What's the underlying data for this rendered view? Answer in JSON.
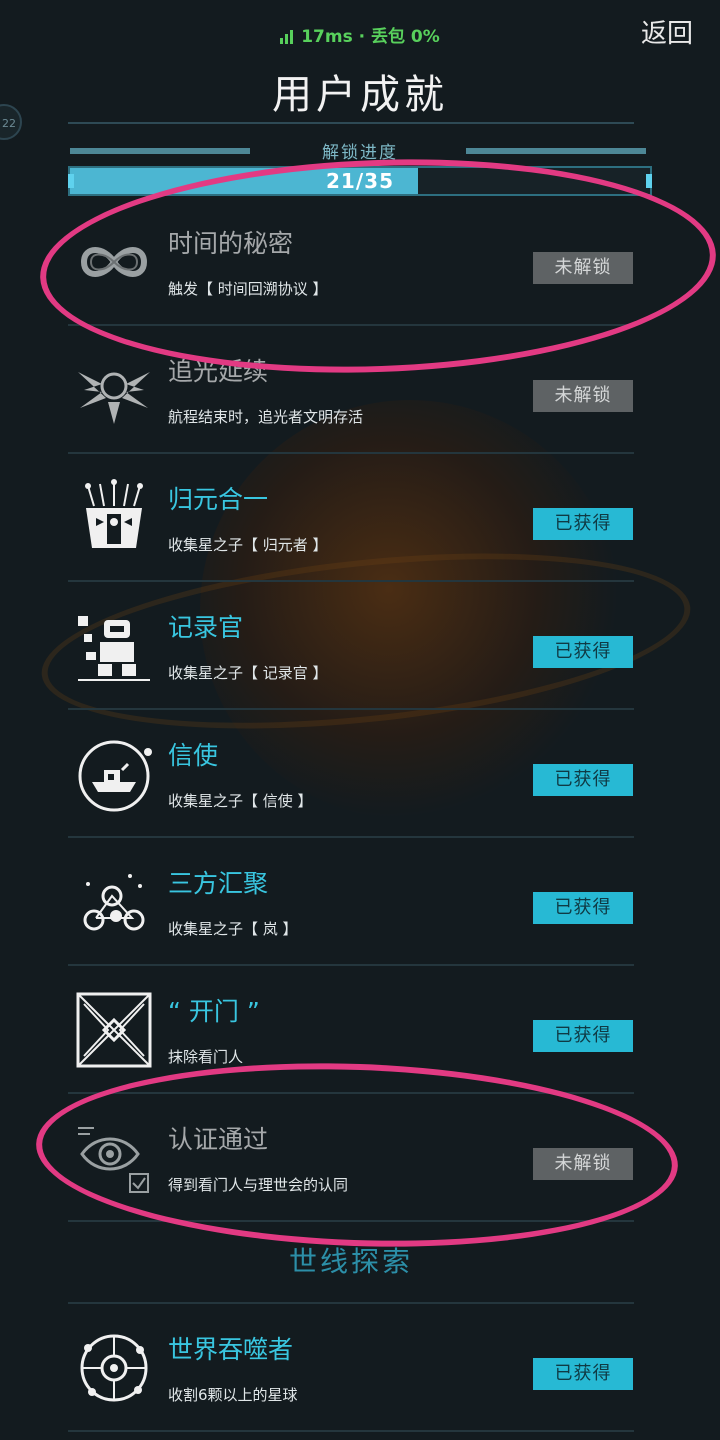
{
  "status": {
    "network": "17ms · 丢包 0%"
  },
  "header": {
    "back_label": "返回",
    "title": "用户成就",
    "side_badge": "22"
  },
  "progress": {
    "label": "解锁进度",
    "text": "21/35",
    "unlocked": 21,
    "total": 35
  },
  "achievements": [
    {
      "name": "时间的秘密",
      "desc": "触发【 时间回溯协议 】",
      "status": "未解锁",
      "icon": "infinity-icon"
    },
    {
      "name": "追光延续",
      "desc": "航程结束时，追光者文明存活",
      "status": "未解锁",
      "icon": "winged-emblem-icon"
    },
    {
      "name": "归元合一",
      "desc": "收集星之子【 归元者 】",
      "status": "已获得",
      "icon": "mask-icon"
    },
    {
      "name": "记录官",
      "desc": "收集星之子【 记录官 】",
      "status": "已获得",
      "icon": "robot-icon"
    },
    {
      "name": "信使",
      "desc": "收集星之子【 信使 】",
      "status": "已获得",
      "icon": "ship-circle-icon"
    },
    {
      "name": "三方汇聚",
      "desc": "收集星之子【 岚 】",
      "status": "已获得",
      "icon": "network-nodes-icon"
    },
    {
      "name": "“ 开门 ”",
      "desc": "抹除看门人",
      "status": "已获得",
      "icon": "gate-icon"
    },
    {
      "name": "认证通过",
      "desc": "得到看门人与理世会的认同",
      "status": "未解锁",
      "icon": "eye-check-icon"
    }
  ],
  "section_title": "世线探索",
  "achievements2": [
    {
      "name": "世界吞噬者",
      "desc": "收割6颗以上的星球",
      "status": "已获得",
      "icon": "planet-devourer-icon"
    }
  ],
  "colors": {
    "accent": "#27b9d4",
    "locked": "#5e6264",
    "highlight": "#e23a83",
    "net": "#58d05c"
  }
}
